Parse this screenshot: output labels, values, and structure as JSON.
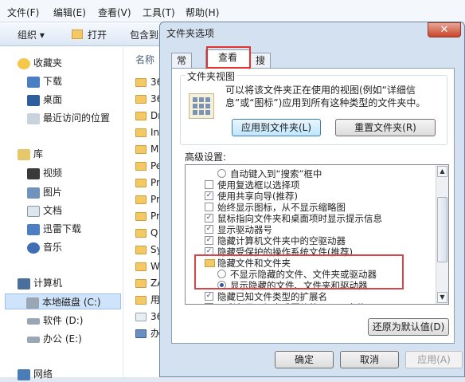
{
  "explorer": {
    "menu": [
      "文件(F)",
      "编辑(E)",
      "查看(V)",
      "工具(T)",
      "帮助(H)"
    ],
    "toolbar": {
      "organize": "组织 ▾",
      "open": "打开",
      "include": "包含到"
    },
    "nav": [
      {
        "label": "收藏夹",
        "icon": "star-icon"
      },
      {
        "label": "下载",
        "icon": "download-folder-icon"
      },
      {
        "label": "桌面",
        "icon": "desktop-icon"
      },
      {
        "label": "最近访问的位置",
        "icon": "recent-places-icon"
      },
      {
        "label": "库",
        "icon": "library-icon"
      },
      {
        "label": "视频",
        "icon": "video-icon"
      },
      {
        "label": "图片",
        "icon": "pictures-icon"
      },
      {
        "label": "文档",
        "icon": "documents-icon"
      },
      {
        "label": "迅雷下载",
        "icon": "download-folder-icon"
      },
      {
        "label": "音乐",
        "icon": "music-icon"
      },
      {
        "label": "计算机",
        "icon": "computer-icon"
      },
      {
        "label": "本地磁盘 (C:)",
        "icon": "drive-icon"
      },
      {
        "label": "软件 (D:)",
        "icon": "drive-icon"
      },
      {
        "label": "办公 (E:)",
        "icon": "drive-icon"
      },
      {
        "label": "网络",
        "icon": "network-icon"
      }
    ],
    "column_header": "名称",
    "files": [
      "36",
      "36",
      "Dr",
      "In",
      "M",
      "Pe",
      "Pr",
      "Pr",
      "Pr",
      "Q",
      "Sy",
      "W",
      "ZA",
      "用",
      "36",
      "办"
    ]
  },
  "dialog": {
    "title": "文件夹选项",
    "close": "✕",
    "tabs": [
      "常规",
      "查看",
      "搜索"
    ],
    "folder_view": {
      "label": "文件夹视图",
      "desc": "可以将该文件夹正在使用的视图(例如“详细信息”或“图标”)应用到所有这种类型的文件夹中。",
      "apply_button": "应用到文件夹(L)",
      "reset_button": "重置文件夹(R)"
    },
    "advanced_label": "高级设置:",
    "advanced": [
      {
        "kind": "radio",
        "on": false,
        "indent": 2,
        "text": "自动键入到“搜索”框中"
      },
      {
        "kind": "check",
        "on": false,
        "indent": 1,
        "text": "使用复选框以选择项"
      },
      {
        "kind": "check",
        "on": true,
        "indent": 1,
        "text": "使用共享向导(推荐)"
      },
      {
        "kind": "check",
        "on": false,
        "indent": 1,
        "text": "始终显示图标，从不显示缩略图"
      },
      {
        "kind": "check",
        "on": true,
        "indent": 1,
        "text": "鼠标指向文件夹和桌面项时显示提示信息"
      },
      {
        "kind": "check",
        "on": true,
        "indent": 1,
        "text": "显示驱动器号"
      },
      {
        "kind": "check",
        "on": true,
        "indent": 1,
        "text": "隐藏计算机文件夹中的空驱动器"
      },
      {
        "kind": "check",
        "on": true,
        "indent": 1,
        "text": "隐藏受保护的操作系统文件(推荐)"
      },
      {
        "kind": "folder",
        "on": false,
        "indent": 1,
        "text": "隐藏文件和文件夹"
      },
      {
        "kind": "radio",
        "on": false,
        "indent": 2,
        "text": "不显示隐藏的文件、文件夹或驱动器"
      },
      {
        "kind": "radio",
        "on": true,
        "indent": 2,
        "text": "显示隐藏的文件、文件夹和驱动器"
      },
      {
        "kind": "check",
        "on": true,
        "indent": 1,
        "text": "隐藏已知文件类型的扩展名"
      },
      {
        "kind": "check",
        "on": true,
        "indent": 1,
        "text": "用彩色显示加密或压缩的 NTFS 文件"
      }
    ],
    "restore_button": "还原为默认值(D)",
    "ok_button": "确定",
    "cancel_button": "取消",
    "apply_button": "应用(A)"
  }
}
